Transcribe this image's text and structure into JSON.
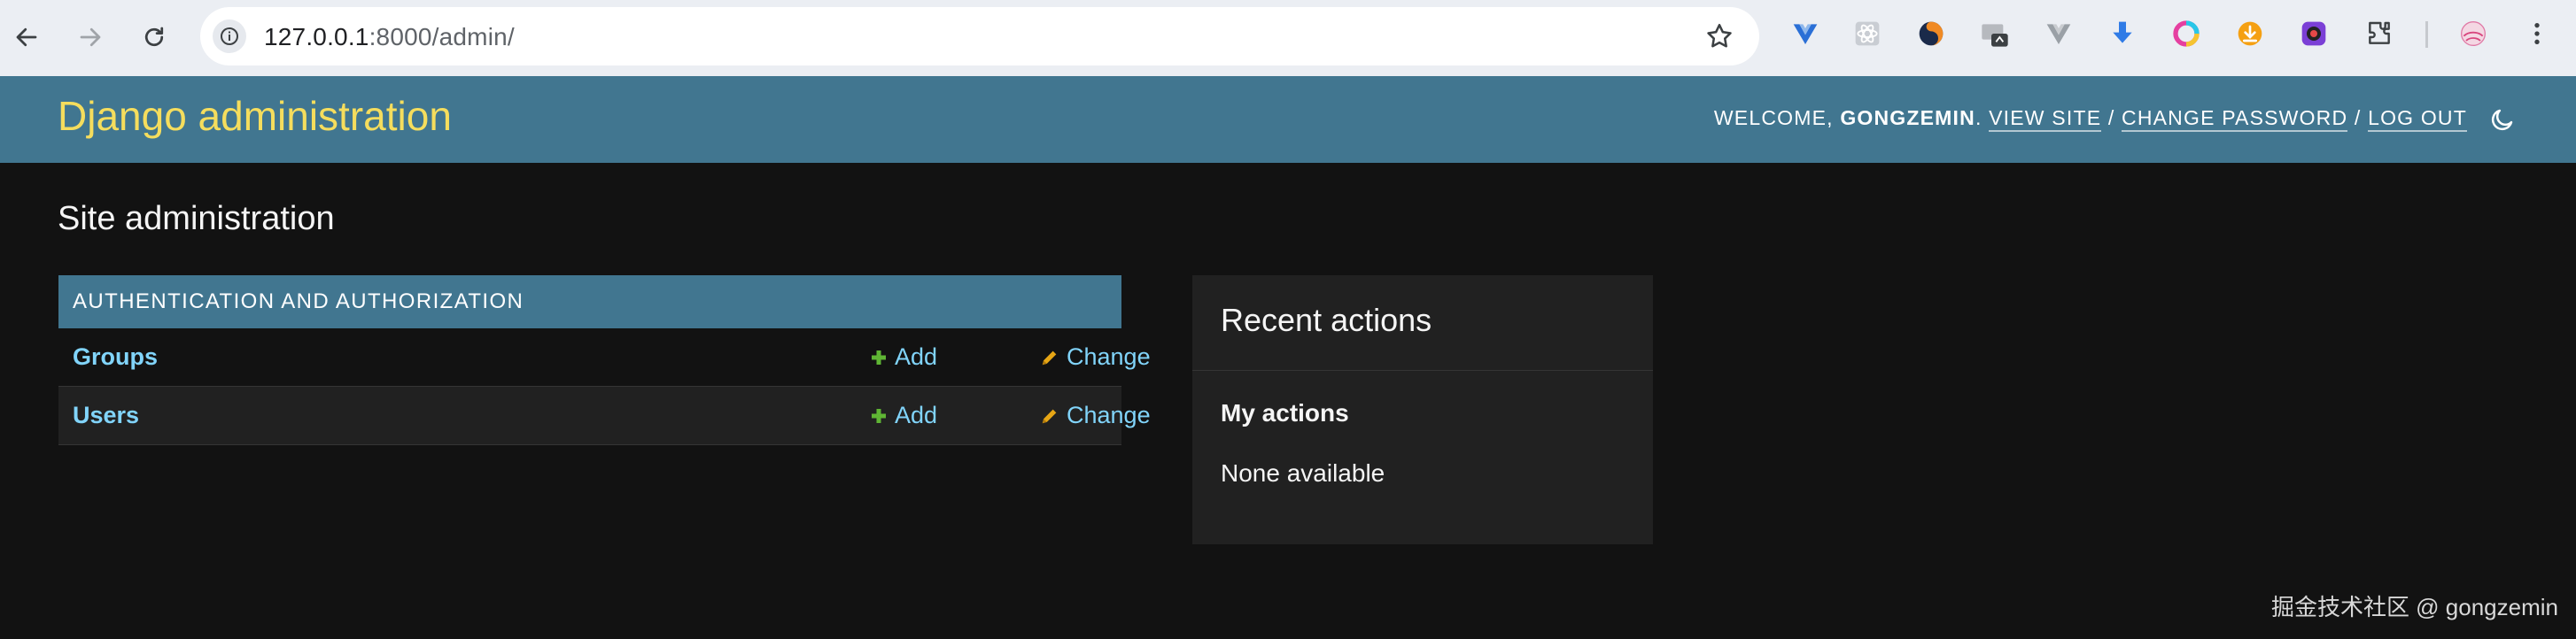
{
  "browser": {
    "url_host": "127.0.0.1",
    "url_path": ":8000/admin/",
    "icons": [
      "back-icon",
      "forward-icon",
      "reload-icon",
      "info-icon",
      "star-icon",
      "extensions-icon",
      "menu-icon"
    ]
  },
  "header": {
    "branding": "Django administration",
    "welcome": "WELCOME, ",
    "username": "GONGZEMIN",
    "period": ".",
    "view_site": "VIEW SITE",
    "sep": " / ",
    "change_password": "CHANGE PASSWORD",
    "log_out": "LOG OUT"
  },
  "content": {
    "title": "Site administration"
  },
  "module": {
    "caption": "AUTHENTICATION AND AUTHORIZATION",
    "rows": [
      {
        "name": "Groups",
        "add": "Add",
        "change": "Change"
      },
      {
        "name": "Users",
        "add": "Add",
        "change": "Change"
      }
    ]
  },
  "recent": {
    "title": "Recent actions",
    "subtitle": "My actions",
    "empty": "None available"
  },
  "watermark": "掘金技术社区 @ gongzemin",
  "colors": {
    "header_bg": "#417690",
    "branding": "#f5dd5d",
    "link": "#81d4fa",
    "add_green": "#5fb534",
    "change_yellow": "#e6a615"
  }
}
